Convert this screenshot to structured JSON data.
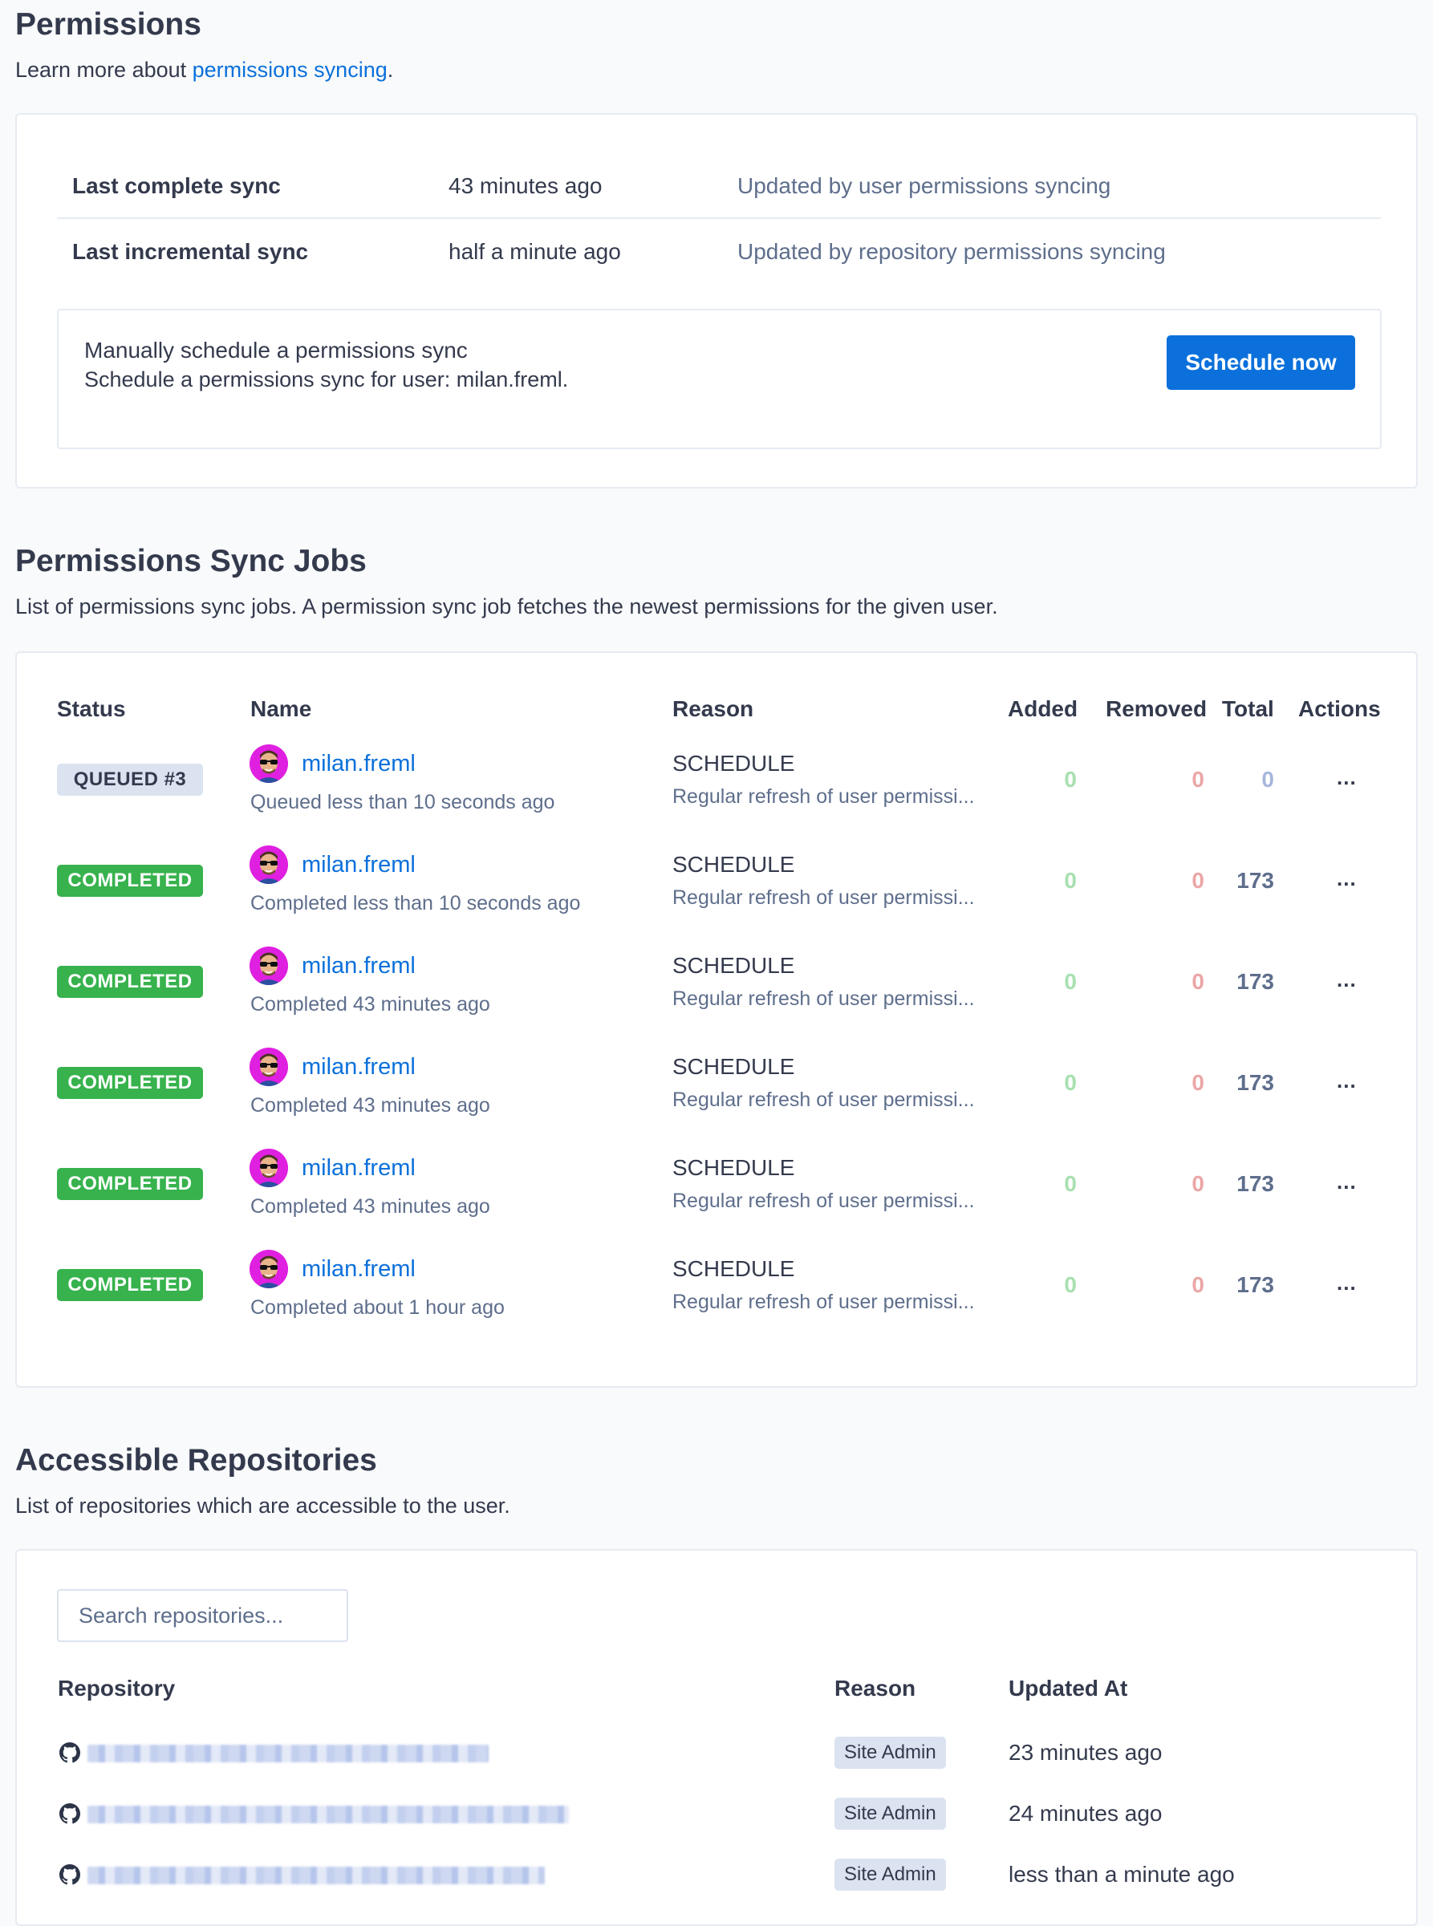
{
  "permissions": {
    "title": "Permissions",
    "subtitle_prefix": "Learn more about ",
    "subtitle_link": "permissions syncing",
    "subtitle_suffix": ".",
    "sync_rows": [
      {
        "label": "Last complete sync",
        "value": "43 minutes ago",
        "description": "Updated by user permissions syncing"
      },
      {
        "label": "Last incremental sync",
        "value": "half a minute ago",
        "description": "Updated by repository permissions syncing"
      }
    ],
    "manual": {
      "title": "Manually schedule a permissions sync",
      "description": "Schedule a permissions sync for user: milan.freml.",
      "button_label": "Schedule now"
    }
  },
  "jobs": {
    "title": "Permissions Sync Jobs",
    "subtitle": "List of permissions sync jobs. A permission sync job fetches the newest permissions for the given user.",
    "columns": [
      "Status",
      "Name",
      "Reason",
      "Added",
      "Removed",
      "Total",
      "Actions"
    ],
    "rows": [
      {
        "status": "QUEUED #3",
        "status_type": "queued",
        "user": "milan.freml",
        "when": "Queued less than 10 seconds ago",
        "reason": "SCHEDULE",
        "reason_desc": "Regular refresh of user permissi...",
        "added": "0",
        "removed": "0",
        "total": "0",
        "actions": "..."
      },
      {
        "status": "COMPLETED",
        "status_type": "completed",
        "user": "milan.freml",
        "when": "Completed less than 10 seconds ago",
        "reason": "SCHEDULE",
        "reason_desc": "Regular refresh of user permissi...",
        "added": "0",
        "removed": "0",
        "total": "173",
        "actions": "..."
      },
      {
        "status": "COMPLETED",
        "status_type": "completed",
        "user": "milan.freml",
        "when": "Completed 43 minutes ago",
        "reason": "SCHEDULE",
        "reason_desc": "Regular refresh of user permissi...",
        "added": "0",
        "removed": "0",
        "total": "173",
        "actions": "..."
      },
      {
        "status": "COMPLETED",
        "status_type": "completed",
        "user": "milan.freml",
        "when": "Completed 43 minutes ago",
        "reason": "SCHEDULE",
        "reason_desc": "Regular refresh of user permissi...",
        "added": "0",
        "removed": "0",
        "total": "173",
        "actions": "..."
      },
      {
        "status": "COMPLETED",
        "status_type": "completed",
        "user": "milan.freml",
        "when": "Completed 43 minutes ago",
        "reason": "SCHEDULE",
        "reason_desc": "Regular refresh of user permissi...",
        "added": "0",
        "removed": "0",
        "total": "173",
        "actions": "..."
      },
      {
        "status": "COMPLETED",
        "status_type": "completed",
        "user": "milan.freml",
        "when": "Completed about 1 hour ago",
        "reason": "SCHEDULE",
        "reason_desc": "Regular refresh of user permissi...",
        "added": "0",
        "removed": "0",
        "total": "173",
        "actions": "..."
      }
    ]
  },
  "repos": {
    "title": "Accessible Repositories",
    "subtitle": "List of repositories which are accessible to the user.",
    "search_placeholder": "Search repositories...",
    "search_value": "",
    "columns": [
      "Repository",
      "Reason",
      "Updated At"
    ],
    "rows": [
      {
        "icon": "github-icon",
        "name": "[redacted]",
        "reason": "Site Admin",
        "updated": "23 minutes ago"
      },
      {
        "icon": "github-icon",
        "name": "[redacted]",
        "reason": "Site Admin",
        "updated": "24 minutes ago"
      },
      {
        "icon": "github-icon",
        "name": "[redacted]",
        "reason": "Site Admin",
        "updated": "less than a minute ago"
      }
    ]
  },
  "colors": {
    "accent": "#0b70db",
    "completed": "#37b24d",
    "queued_bg": "#dbe2f0",
    "added": "#a8e0b0",
    "removed": "#eba6a6"
  }
}
